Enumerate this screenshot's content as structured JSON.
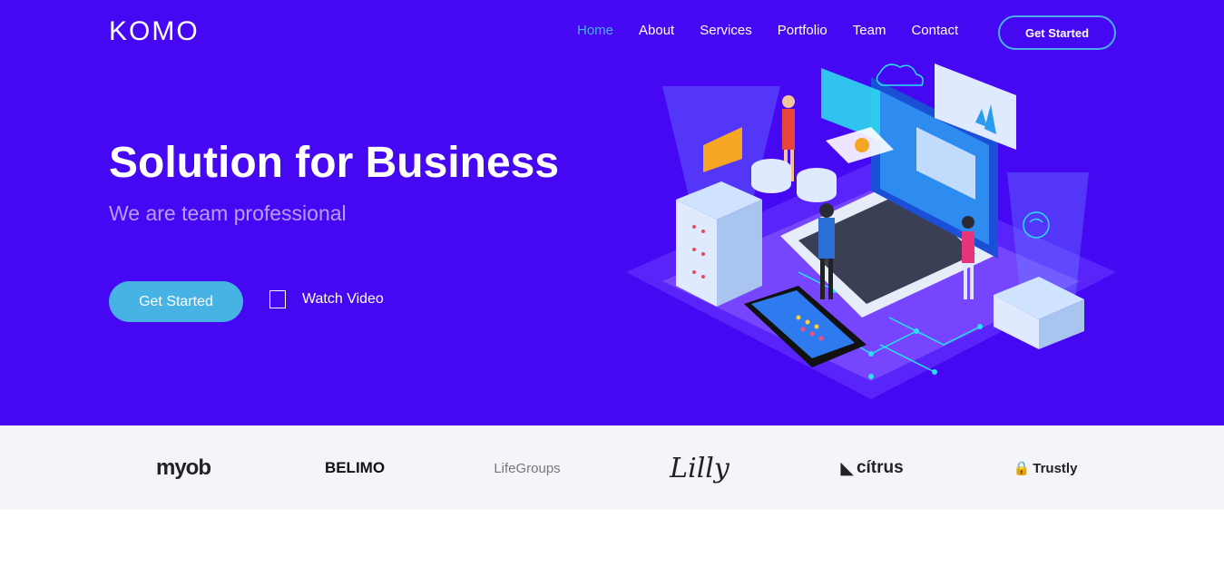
{
  "header": {
    "logo": "KOMO",
    "nav": [
      "Home",
      "About",
      "Services",
      "Portfolio",
      "Team",
      "Contact"
    ],
    "active_nav": "Home",
    "cta_label": "Get Started"
  },
  "hero": {
    "title": "Solution for Business",
    "subtitle": "We are team professional",
    "primary_button": "Get Started",
    "video_link": "Watch Video"
  },
  "clients": [
    "myob",
    "BELIMO",
    "LifeGroups",
    "Lilly",
    "cítrus",
    "Trustly"
  ],
  "colors": {
    "hero_bg": "#4608f3",
    "accent": "#47b2e4",
    "clients_bg": "#f3f5fa"
  }
}
